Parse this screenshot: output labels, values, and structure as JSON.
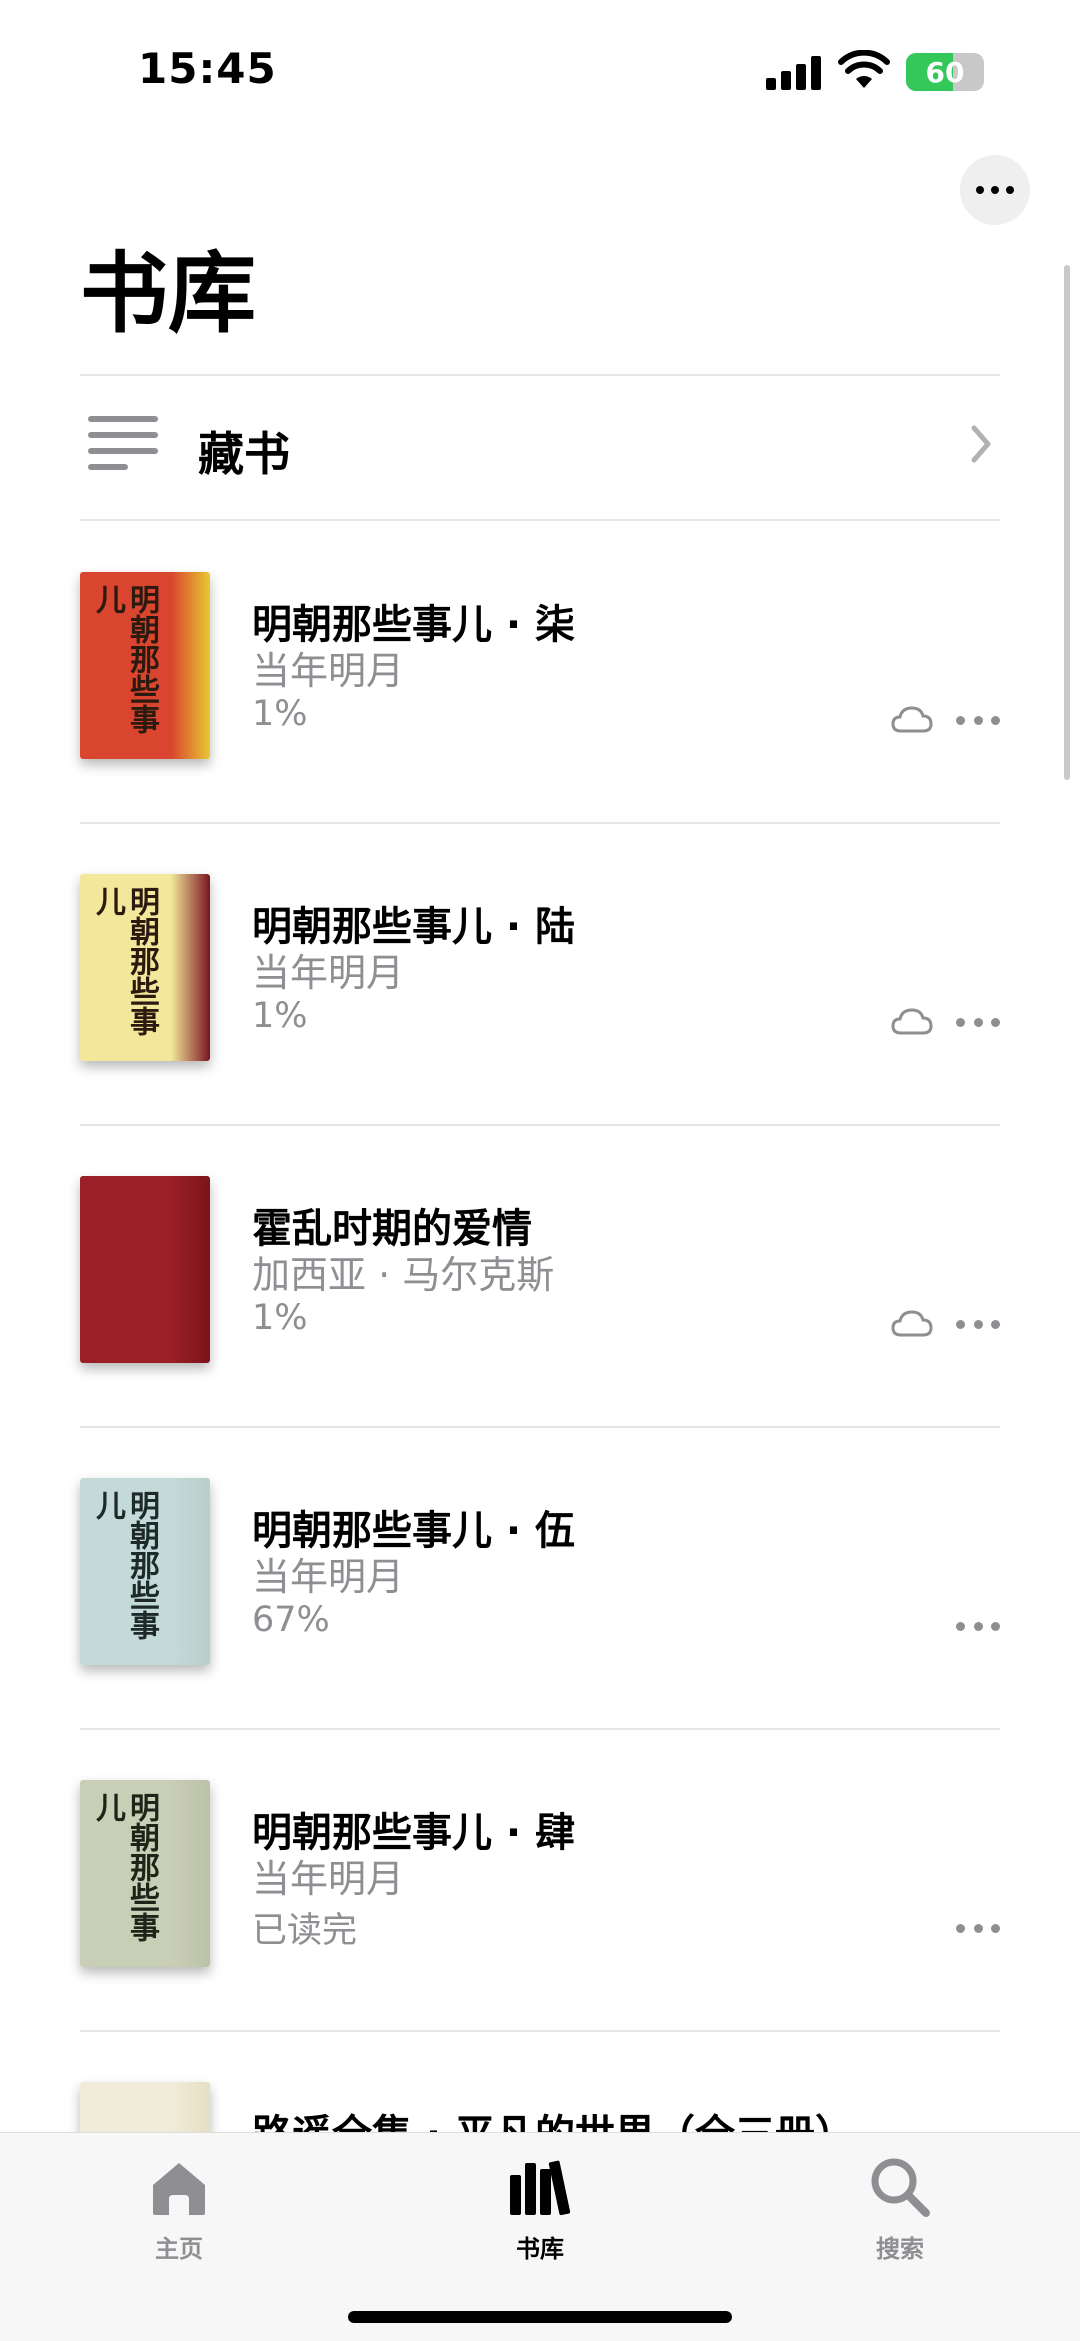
{
  "status_bar": {
    "time": "15:45",
    "battery": "60",
    "battery_level": 0.6
  },
  "header": {
    "title": "书库",
    "more_icon": "ellipsis-icon"
  },
  "collection": {
    "label": "藏书"
  },
  "books": [
    {
      "title": "明朝那些事儿 · 柒",
      "author": "当年明月",
      "progress": "1%",
      "cloud": true,
      "cover_text": "明朝那些事儿",
      "cover_bg": "#d9452e",
      "cover_text_color": "#2a1a10",
      "cover_accent": "#e8c832"
    },
    {
      "title": "明朝那些事儿 · 陆",
      "author": "当年明月",
      "progress": "1%",
      "cloud": true,
      "cover_text": "明朝那些事儿",
      "cover_bg": "#f2e79a",
      "cover_text_color": "#2a1a10",
      "cover_accent": "#7a1420"
    },
    {
      "title": "霍乱时期的爱情",
      "author": "加西亚 · 马尔克斯",
      "progress": "1%",
      "cloud": true,
      "cover_text": "",
      "cover_bg": "#9b1f26",
      "cover_text_color": "#ffffff",
      "cover_accent": "#7a1419"
    },
    {
      "title": "明朝那些事儿 · 伍",
      "author": "当年明月",
      "progress": "67%",
      "cloud": false,
      "cover_text": "明朝那些事儿",
      "cover_bg": "#c4dad8",
      "cover_text_color": "#1e2a2a",
      "cover_accent": "#b8cfcc"
    },
    {
      "title": "明朝那些事儿 · 肆",
      "author": "当年明月",
      "progress": "已读完",
      "cloud": false,
      "cover_text": "明朝那些事儿",
      "cover_bg": "#c9ceb6",
      "cover_text_color": "#1e2418",
      "cover_accent": "#bcc2a8"
    },
    {
      "title": "路遥全集 · 平凡的世界（全三册）",
      "author": "",
      "progress": "",
      "cloud": false,
      "cover_text": "",
      "cover_bg": "#f1ecd9",
      "cover_text_color": "#333333",
      "cover_accent": "#e6dfc4"
    }
  ],
  "tabs": [
    {
      "label": "主页",
      "icon": "home-icon",
      "active": false
    },
    {
      "label": "书库",
      "icon": "library-icon",
      "active": true
    },
    {
      "label": "搜索",
      "icon": "search-icon",
      "active": false
    }
  ],
  "colors": {
    "active": "#000000",
    "inactive": "#8e8e93",
    "divider": "#e6e6e6"
  }
}
